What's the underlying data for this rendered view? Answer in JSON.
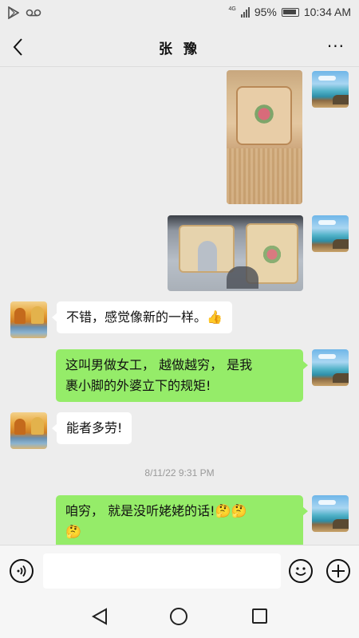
{
  "status_bar": {
    "network_label": "4G",
    "battery_percent": "95%",
    "time": "10:34 AM"
  },
  "header": {
    "title": "张 豫",
    "more_label": "···"
  },
  "messages": [
    {
      "side": "self",
      "type": "image",
      "image_desc": "rug-photo-1"
    },
    {
      "side": "self",
      "type": "image",
      "image_desc": "rug-photo-2"
    },
    {
      "side": "other",
      "type": "text",
      "text": "不错，感觉像新的一样。",
      "emoji": "👍"
    },
    {
      "side": "self",
      "type": "text",
      "line1": "这叫男做女工， 越做越穷， 是我",
      "line2": "裹小脚的外婆立下的规矩!"
    },
    {
      "side": "other",
      "type": "text",
      "text": "能者多劳!"
    },
    {
      "side": "self",
      "type": "text",
      "line1": "咱穷， 就是没听姥姥的话!",
      "emoji1": "🤔🤔",
      "emoji2": "🤔"
    }
  ],
  "timestamp": "8/11/22 9:31 PM",
  "input": {
    "placeholder": ""
  },
  "colors": {
    "outgoing_bubble": "#95ec69",
    "incoming_bubble": "#ffffff",
    "background": "#ededed"
  },
  "icons": {
    "status_left": [
      "play-store-icon",
      "voicemail-icon"
    ],
    "header_back": "back-arrow-icon",
    "input_left": "voice-icon",
    "input_right": [
      "emoji-icon",
      "plus-icon"
    ],
    "nav": [
      "nav-back-icon",
      "nav-home-icon",
      "nav-recent-icon"
    ]
  }
}
